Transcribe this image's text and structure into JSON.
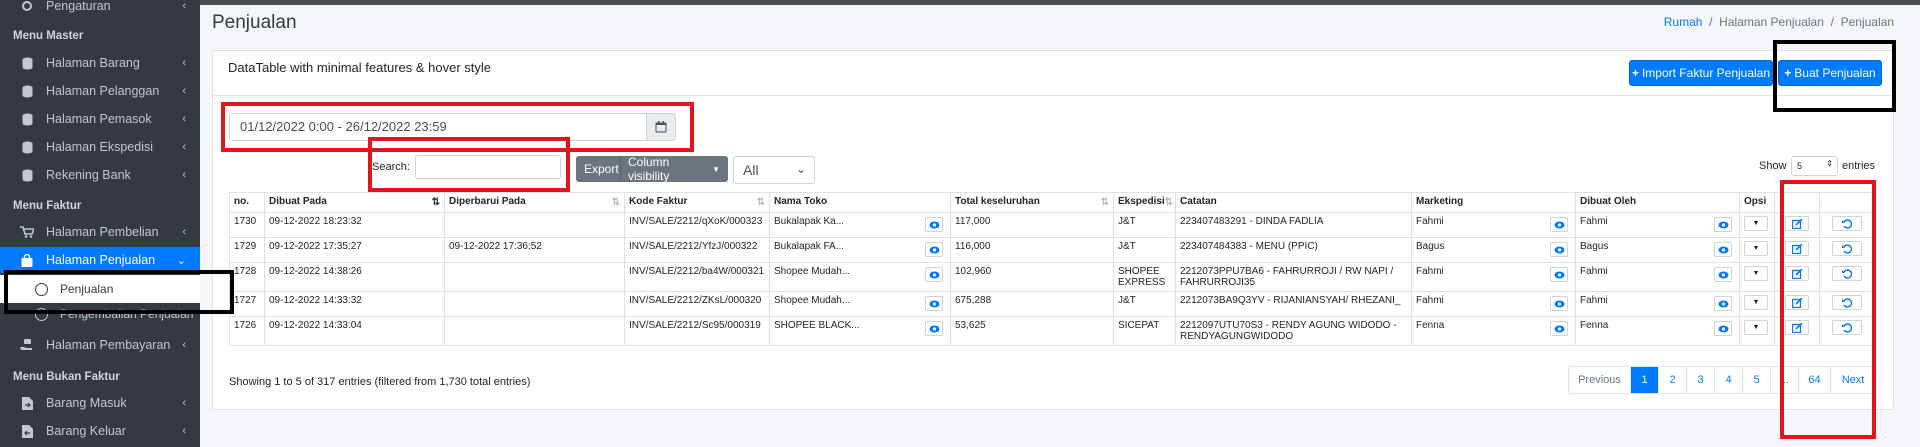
{
  "sidebar": {
    "top_partial_label": "Pengaturan",
    "sections": [
      {
        "header": "Menu Master"
      },
      {
        "header": "Menu Faktur"
      },
      {
        "header": "Menu Bukan Faktur"
      }
    ],
    "master_items": [
      {
        "label": "Halaman Barang",
        "icon": "database-icon"
      },
      {
        "label": "Halaman Pelanggan",
        "icon": "database-icon"
      },
      {
        "label": "Halaman Pemasok",
        "icon": "database-icon"
      },
      {
        "label": "Halaman Ekspedisi",
        "icon": "database-icon"
      },
      {
        "label": "Rekening Bank",
        "icon": "database-icon"
      }
    ],
    "faktur_items": [
      {
        "label": "Halaman Pembelian",
        "icon": "cart-icon"
      },
      {
        "label": "Halaman Penjualan",
        "icon": "shopping-bag-icon"
      },
      {
        "label": "Penjualan",
        "icon": "circle-icon"
      },
      {
        "label": "Pengembalian Penjualan",
        "icon": "circle-icon"
      },
      {
        "label": "Halaman Pembayaran",
        "icon": "hand-money-icon"
      }
    ],
    "bukan_faktur_items": [
      {
        "label": "Barang Masuk",
        "icon": "file-import-icon"
      },
      {
        "label": "Barang Keluar",
        "icon": "file-export-icon"
      }
    ]
  },
  "header": {
    "title": "Penjualan",
    "breadcrumb": [
      "Rumah",
      "Halaman Penjualan",
      "Penjualan"
    ]
  },
  "card": {
    "title": "DataTable with minimal features & hover style",
    "import_button": "Import Faktur Penjualan",
    "create_button": "Buat Penjualan"
  },
  "filters": {
    "date_range": "01/12/2022 0:00 - 26/12/2022 23:59",
    "search_label": "Search:",
    "search_value": "",
    "export_label": "Export",
    "column_visibility_label": "Column visibility",
    "status_filter": "All",
    "show_label": "Show",
    "page_length": "5",
    "entries_label": "entries"
  },
  "table": {
    "columns": [
      "no.",
      "Dibuat Pada",
      "Diperbarui Pada",
      "Kode Faktur",
      "Nama Toko",
      "Total keseluruhan",
      "Ekspedisi",
      "Catatan",
      "Marketing",
      "Dibuat Oleh",
      "Opsi"
    ],
    "rows": [
      {
        "no": "1730",
        "dibuat": "09-12-2022 18:23:32",
        "diperbarui": "",
        "kode": "INV/SALE/2212/qXoK/000323",
        "toko": "Bukalapak Ka...",
        "total": "117,000",
        "ekspedisi": "J&T",
        "catatan": "223407483291 - DINDA FADLIA",
        "marketing": "Fahmi",
        "oleh": "Fahmi"
      },
      {
        "no": "1729",
        "dibuat": "09-12-2022 17:35:27",
        "diperbarui": "09-12-2022 17:36:52",
        "kode": "INV/SALE/2212/YfzJ/000322",
        "toko": "Bukalapak FA...",
        "total": "116,000",
        "ekspedisi": "J&T",
        "catatan": "223407484383 - MENU (PPIC)",
        "marketing": "Bagus",
        "oleh": "Bagus"
      },
      {
        "no": "1728",
        "dibuat": "09-12-2022 14:38:26",
        "diperbarui": "",
        "kode": "INV/SALE/2212/ba4W/000321",
        "toko": "Shopee Mudah...",
        "total": "102,960",
        "ekspedisi": "SHOPEE EXPRESS",
        "catatan": "2212073PPU7BA6 - FAHRURROJI / RW NAPI / FAHRURROJI35",
        "marketing": "Fahmi",
        "oleh": "Fahmi"
      },
      {
        "no": "1727",
        "dibuat": "09-12-2022 14:33:32",
        "diperbarui": "",
        "kode": "INV/SALE/2212/ZKsL/000320",
        "toko": "Shopee Mudah...",
        "total": "675,288",
        "ekspedisi": "J&T",
        "catatan": "2212073BA9Q3YV - RIJANIANSYAH/ RHEZANI_",
        "marketing": "Fahmi",
        "oleh": "Fahmi"
      },
      {
        "no": "1726",
        "dibuat": "09-12-2022 14:33:04",
        "diperbarui": "",
        "kode": "INV/SALE/2212/Sc95/000319",
        "toko": "SHOPEE BLACK...",
        "total": "53,625",
        "ekspedisi": "SICEPAT",
        "catatan": "2212097UTU70S3 - RENDY AGUNG WIDODO - RENDYAGUNGWIDODO",
        "marketing": "Fenna",
        "oleh": "Fenna"
      }
    ]
  },
  "footer": {
    "info": "Showing 1 to 5 of 317 entries (filtered from 1,730 total entries)",
    "pagination": [
      "Previous",
      "1",
      "2",
      "3",
      "4",
      "5",
      "...",
      "64",
      "Next"
    ]
  },
  "colors": {
    "sidebar_bg": "#343a40",
    "primary": "#007bff",
    "annotation_red": "#e3141b",
    "annotation_black": "#000000"
  }
}
